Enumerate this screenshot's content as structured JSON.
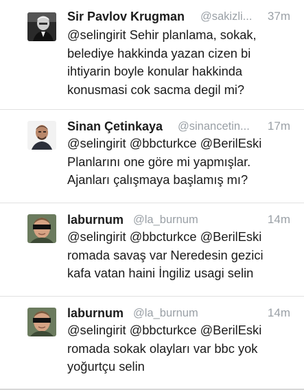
{
  "tweets": [
    {
      "name": "Sir Pavlov Krugman",
      "handle": "@sakizli...",
      "time": "37m",
      "text": "@selingirit Sehir planlama, sokak,\nbelediye hakkinda yazan cizen bi\nihtiyarin boyle konular hakkinda\nkonusmasi cok sacma degil mi?",
      "avatar": "grayscale-man-portrait"
    },
    {
      "name": "Sinan Çetinkaya",
      "handle": "@sinancetin...",
      "time": "17m",
      "text": "@selingirit @bbcturkce @BerilEski\nPlanlarını one göre mi yapmışlar.\nAjanları çalışmaya başlamış mı?",
      "avatar": "bald-man-portrait"
    },
    {
      "name": "laburnum",
      "handle": "@la_burnum",
      "time": "14m",
      "text": "@selingirit @bbcturkce @BerilEski\nromada savaş var Neredesin gezici\nkafa vatan haini İngiliz usagi selin",
      "avatar": "masked-face-portrait"
    },
    {
      "name": "laburnum",
      "handle": "@la_burnum",
      "time": "14m",
      "text": "@selingirit @bbcturkce @BerilEski\nromada sokak olayları var bbc yok\nyoğurtçu selin",
      "avatar": "masked-face-portrait"
    }
  ]
}
